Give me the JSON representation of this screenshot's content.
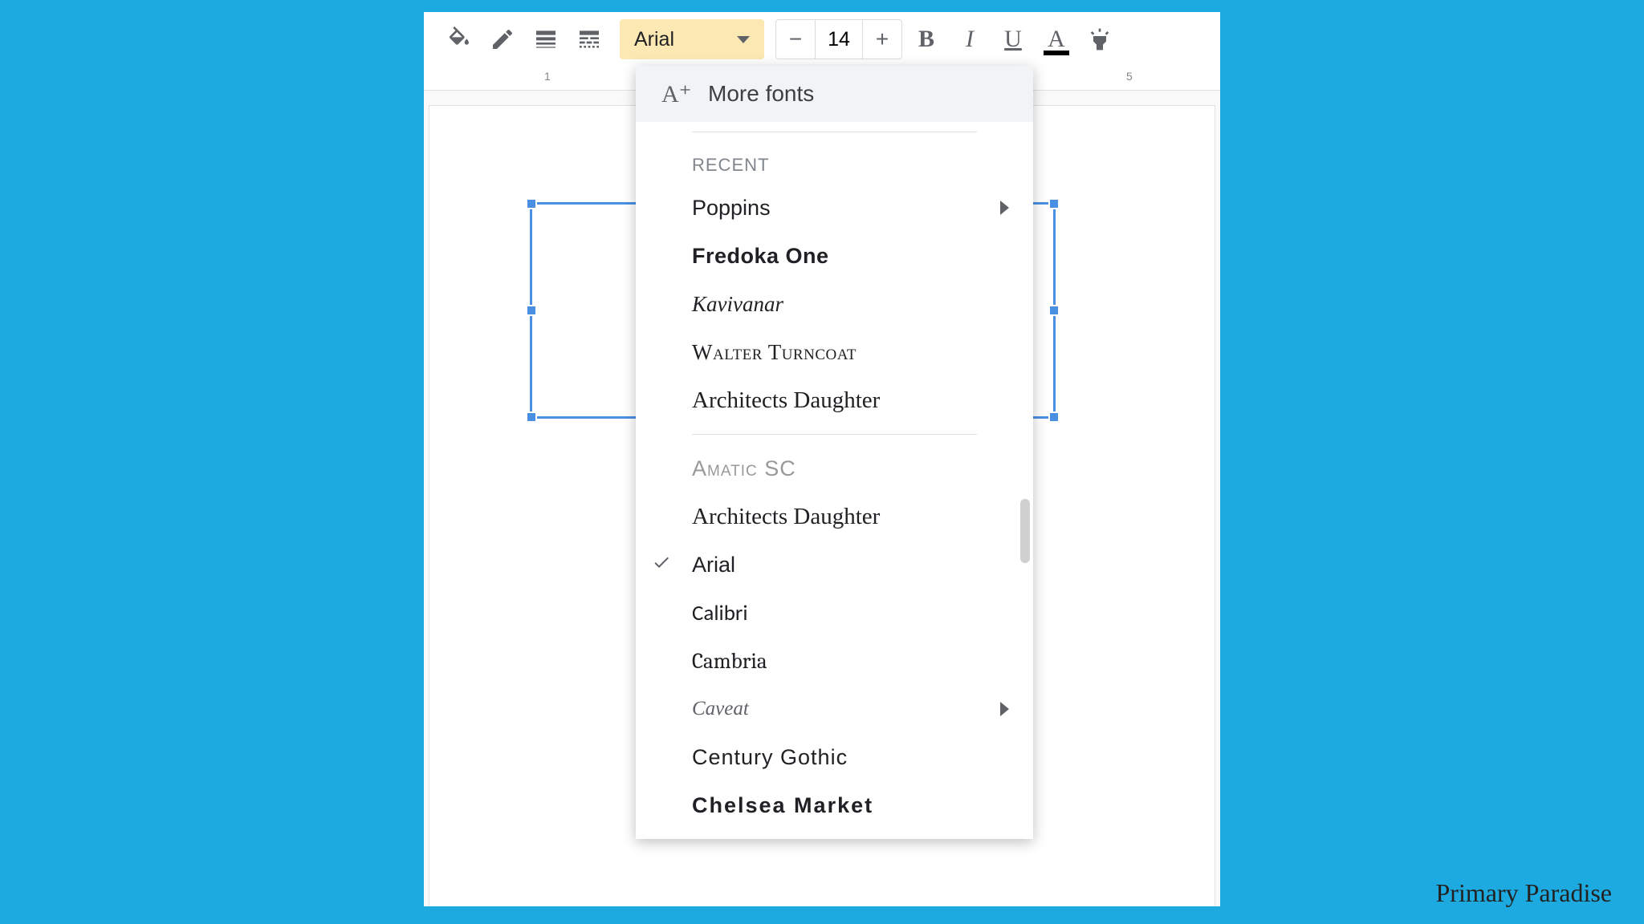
{
  "toolbar": {
    "font_name": "Arial",
    "font_size": "14"
  },
  "ruler": {
    "mark1": "1",
    "mark5": "5"
  },
  "dropdown": {
    "more_fonts": "More fonts",
    "recent_label": "RECENT",
    "recent_fonts": [
      {
        "name": "Poppins",
        "css": "font-poppins",
        "has_submenu": true
      },
      {
        "name": "Fredoka One",
        "css": "font-fredoka",
        "has_submenu": false
      },
      {
        "name": "Kavivanar",
        "css": "font-kavivanar",
        "has_submenu": false
      },
      {
        "name": "Walter Turncoat",
        "css": "font-walter",
        "has_submenu": false
      },
      {
        "name": "Architects Daughter",
        "css": "font-architects",
        "has_submenu": false
      }
    ],
    "all_fonts": [
      {
        "name": "Amatic SC",
        "css": "font-amatic",
        "has_submenu": false,
        "checked": false
      },
      {
        "name": "Architects Daughter",
        "css": "font-architects",
        "has_submenu": false,
        "checked": false
      },
      {
        "name": "Arial",
        "css": "font-arial",
        "has_submenu": false,
        "checked": true
      },
      {
        "name": "Calibri",
        "css": "font-calibri",
        "has_submenu": false,
        "checked": false
      },
      {
        "name": "Cambria",
        "css": "font-cambria",
        "has_submenu": false,
        "checked": false
      },
      {
        "name": "Caveat",
        "css": "font-caveat",
        "has_submenu": true,
        "checked": false
      },
      {
        "name": "Century Gothic",
        "css": "font-century",
        "has_submenu": false,
        "checked": false
      },
      {
        "name": "Chelsea Market",
        "css": "font-chelsea",
        "has_submenu": false,
        "checked": false
      }
    ]
  },
  "watermark": "Primary Paradise"
}
